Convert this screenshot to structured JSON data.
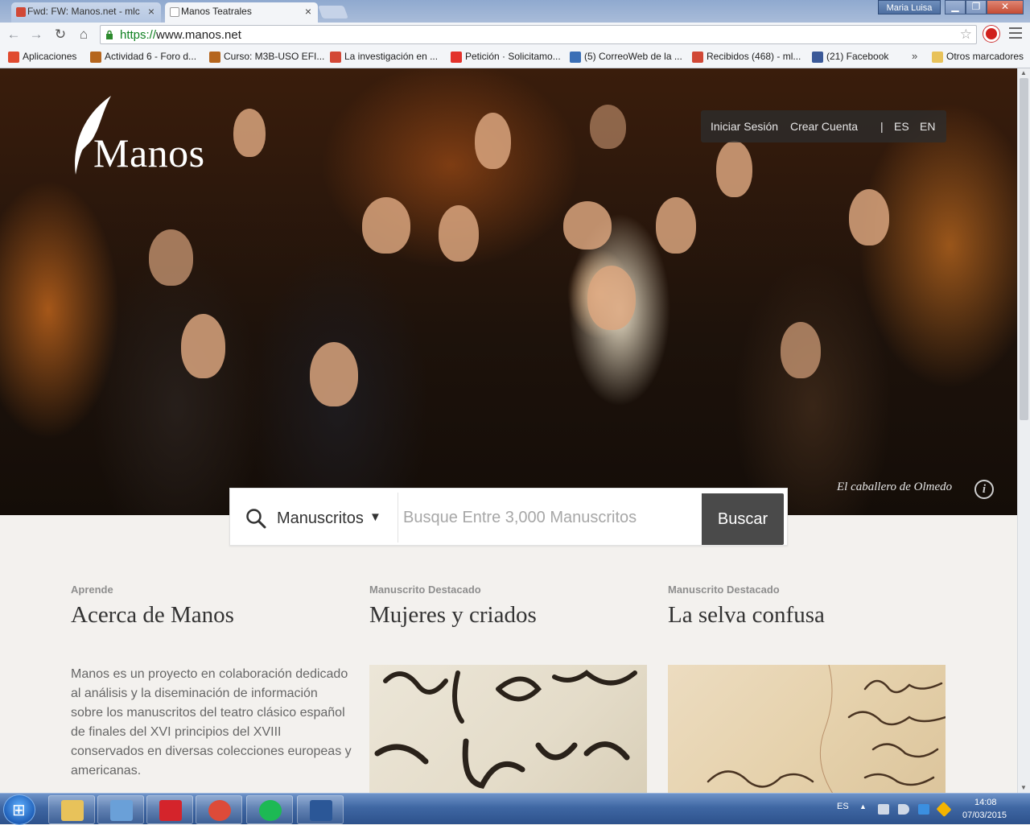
{
  "browser": {
    "tabs": [
      {
        "title": "Fwd: FW: Manos.net - mlc",
        "active": false
      },
      {
        "title": "Manos Teatrales",
        "active": true
      }
    ],
    "window_user": "Maria Luisa",
    "url_scheme": "https://",
    "url_rest": "www.manos.net",
    "bookmarks": [
      {
        "label": "Aplicaciones",
        "icon": "apps-grid-icon",
        "color": "#e04a2f"
      },
      {
        "label": "Actividad 6 - Foro d...",
        "icon": "moodle-icon",
        "color": "#b5651d"
      },
      {
        "label": "Curso: M3B-USO EFI...",
        "icon": "moodle-icon",
        "color": "#b5651d"
      },
      {
        "label": "La investigación en ...",
        "icon": "google-plus-icon",
        "color": "#d34836"
      },
      {
        "label": "Petición · Solicitamo...",
        "icon": "change-org-icon",
        "color": "#e3322b"
      },
      {
        "label": "(5) CorreoWeb de la ...",
        "icon": "mail-icon",
        "color": "#3b6fb6"
      },
      {
        "label": "Recibidos (468) - ml...",
        "icon": "gmail-icon",
        "color": "#d14836"
      },
      {
        "label": "(21) Facebook",
        "icon": "facebook-icon",
        "color": "#3b5998"
      }
    ],
    "bookmarks_more": "»",
    "other_bookmarks": "Otros marcadores"
  },
  "site": {
    "logo_text": "Manos",
    "auth": {
      "login": "Iniciar Sesión",
      "signup": "Crear Cuenta",
      "separator": "|",
      "lang_es": "ES",
      "lang_en": "EN"
    },
    "hero_caption": "El caballero de Olmedo",
    "search": {
      "category": "Manuscritos",
      "caret": "▼",
      "placeholder": "Busque Entre 3,000 Manuscritos",
      "button": "Buscar"
    },
    "columns": [
      {
        "kicker": "Aprende",
        "title": "Acerca de Manos"
      },
      {
        "kicker": "Manuscrito Destacado",
        "title": "Mujeres y criados"
      },
      {
        "kicker": "Manuscrito Destacado",
        "title": "La selva confusa"
      }
    ],
    "about_text": "Manos es un proyecto en colaboración dedicado al análisis y la diseminación de información sobre los manuscritos del teatro clásico español de finales del XVI principios del XVIII conservados en diversas colecciones europeas y americanas."
  },
  "taskbar": {
    "apps": [
      {
        "name": "file-explorer-icon",
        "color": "#e8c25a"
      },
      {
        "name": "image-viewer-icon",
        "color": "#6aa0d8"
      },
      {
        "name": "acrobat-reader-icon",
        "color": "#d4242b"
      },
      {
        "name": "chrome-icon",
        "color": "#dd4b39"
      },
      {
        "name": "spotify-icon",
        "color": "#1db954"
      },
      {
        "name": "word-icon",
        "color": "#2b5797"
      }
    ],
    "language": "ES",
    "time": "14:08",
    "date": "07/03/2015"
  }
}
